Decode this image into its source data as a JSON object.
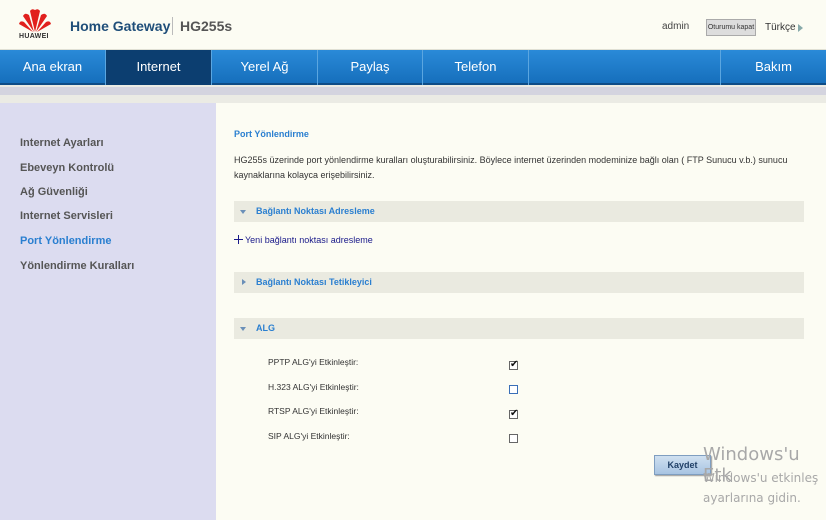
{
  "header": {
    "logo_text": "HUAWEI",
    "brand": "Home Gateway",
    "model": "HG255s",
    "user": "admin",
    "logout_label": "Oturumu kapat",
    "language": "Türkçe"
  },
  "nav": {
    "items": [
      {
        "label": "Ana ekran"
      },
      {
        "label": "Internet"
      },
      {
        "label": "Yerel Ağ"
      },
      {
        "label": "Paylaş"
      },
      {
        "label": "Telefon"
      },
      {
        "label": "Bakım"
      }
    ],
    "active": "Internet"
  },
  "sidebar": {
    "items": [
      {
        "label": "Internet Ayarları"
      },
      {
        "label": "Ebeveyn Kontrolü"
      },
      {
        "label": "Ağ Güvenliği"
      },
      {
        "label": "Internet Servisleri"
      },
      {
        "label": "Port Yönlendirme"
      },
      {
        "label": "Yönlendirme Kuralları"
      }
    ],
    "active": "Port Yönlendirme"
  },
  "main": {
    "title": "Port Yönlendirme",
    "description": "HG255s üzerinde port yönlendirme kuralları oluşturabilirsiniz. Böylece internet üzerinden modeminize bağlı olan ( FTP Sunucu v.b.) sunucu kaynaklarına kolayca erişebilirsiniz.",
    "sections": {
      "port_mapping": {
        "label": "Bağlantı Noktası Adresleme",
        "expanded": true
      },
      "port_trigger": {
        "label": "Bağlantı Noktası Tetikleyici",
        "expanded": false
      },
      "alg": {
        "label": "ALG",
        "expanded": true
      }
    },
    "add_link": "Yeni bağlantı noktası adresleme",
    "alg_options": [
      {
        "label": "PPTP ALG'yi Etkinleştir:",
        "checked": true
      },
      {
        "label": "H.323 ALG'yi Etkinleştir:",
        "checked": false
      },
      {
        "label": "RTSP ALG'yi Etkinleştir:",
        "checked": true
      },
      {
        "label": "SIP ALG'yi Etkinleştir:",
        "checked": false
      }
    ],
    "save_label": "Kaydet"
  },
  "watermark": {
    "line1": "Windows'u Etk",
    "line2": "Windows'u etkinleş",
    "line3": "ayarlarına gidin."
  },
  "colors": {
    "nav_bg": "#1f7fcf",
    "nav_active": "#0c3e70",
    "accent": "#2a7fd0",
    "sidebar_bg": "#dcdcf0",
    "content_bg": "#fcfcf3"
  }
}
